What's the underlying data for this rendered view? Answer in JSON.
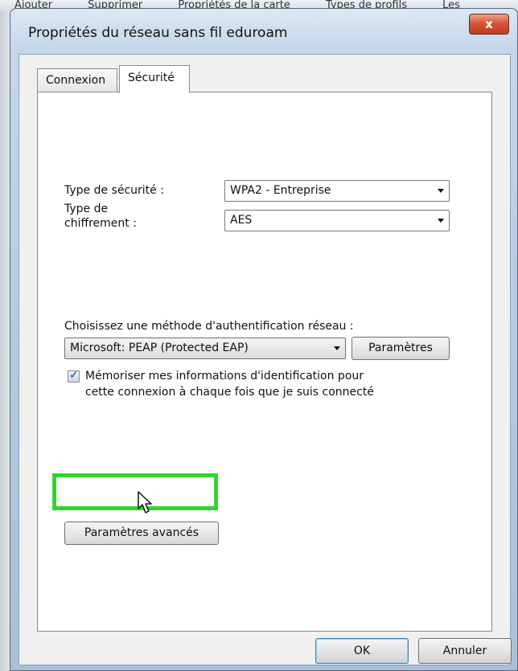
{
  "background": {
    "menu_items": [
      "Ajouter",
      "Supprimer",
      "Propriétés de la carte",
      "Types de profils",
      "Les"
    ]
  },
  "window": {
    "title": "Propriétés du réseau sans fil eduroam",
    "close_label": "x"
  },
  "tabs": [
    {
      "label": "Connexion",
      "active": false
    },
    {
      "label": "Sécurité",
      "active": true
    }
  ],
  "security": {
    "type_label": "Type de sécurité :",
    "type_value": "WPA2 - Entreprise",
    "encryption_label_line1": "Type de",
    "encryption_label_line2": "chiffrement :",
    "encryption_value": "AES",
    "auth_method_label": "Choisissez une méthode d'authentification réseau :",
    "auth_method_value": "Microsoft: PEAP (Protected EAP)",
    "params_button": "Paramètres",
    "remember_checked": true,
    "remember_line1": "Mémoriser mes informations d'identification pour",
    "remember_line2": "cette connexion à chaque fois que je suis connecté",
    "advanced_button": "Paramètres avancés"
  },
  "footer": {
    "ok_label": "OK",
    "cancel_label": "Annuler"
  },
  "colors": {
    "highlight": "#2fd62d",
    "close_button": "#d7553a"
  }
}
